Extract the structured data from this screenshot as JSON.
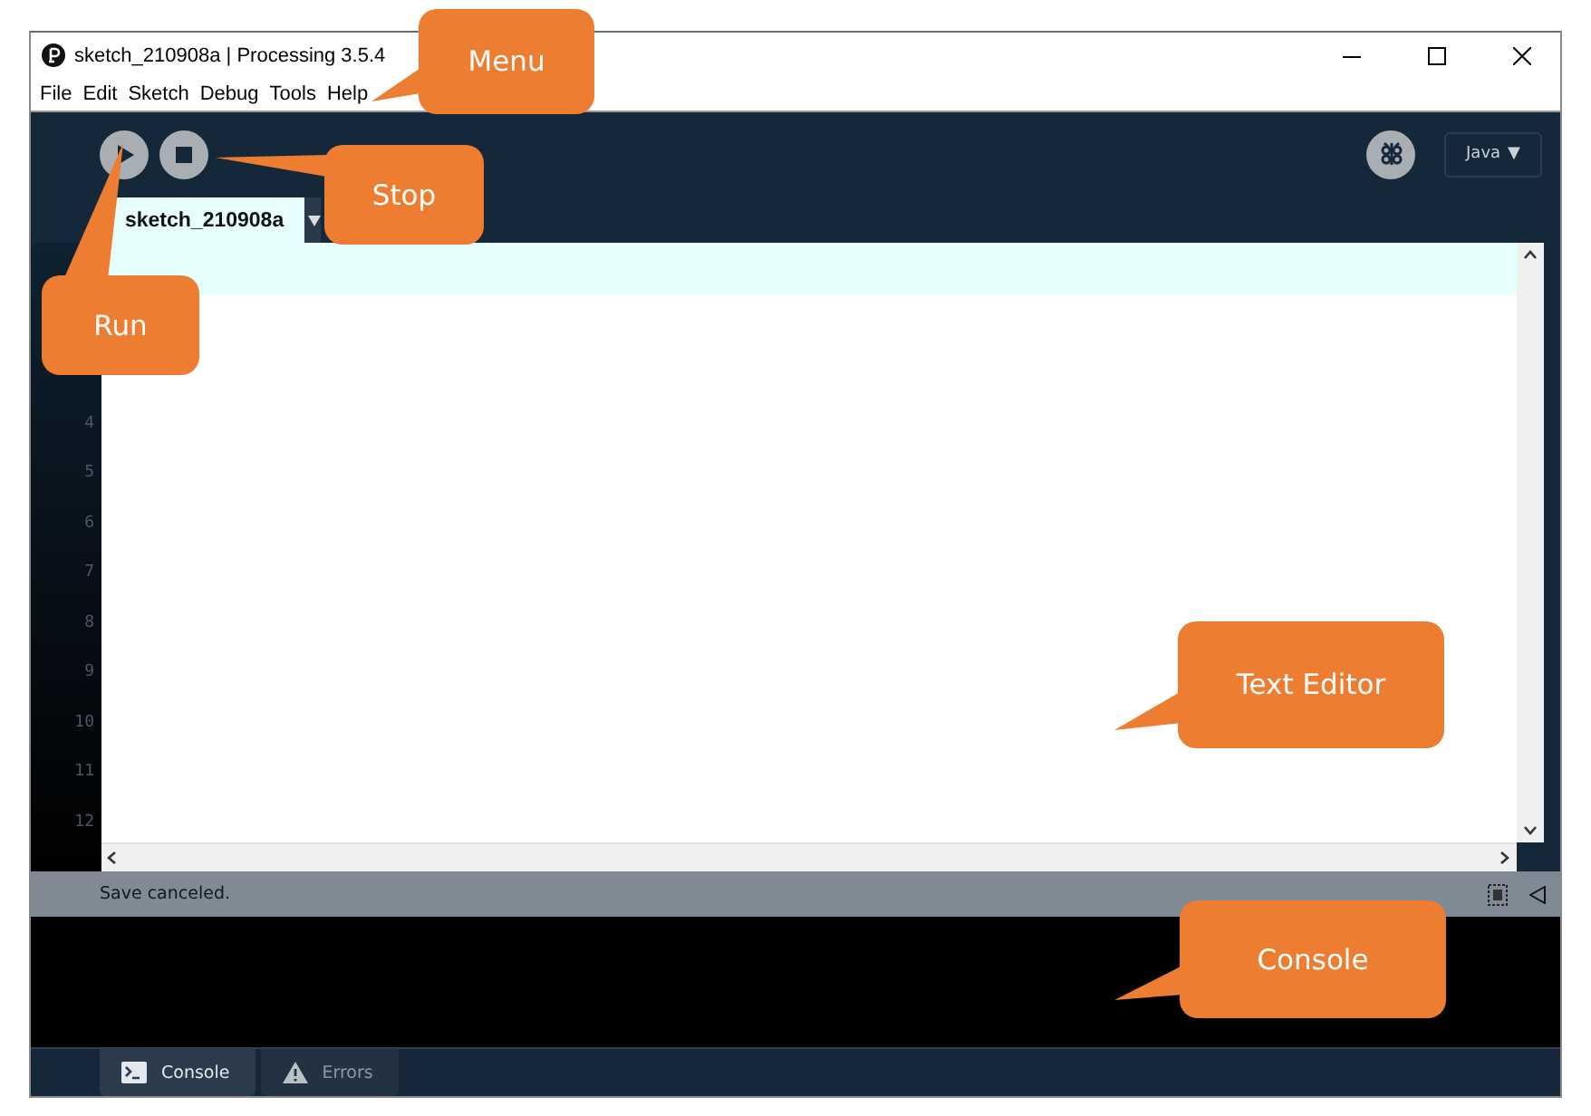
{
  "window": {
    "title": "sketch_210908a | Processing 3.5.4"
  },
  "menu": [
    "File",
    "Edit",
    "Sketch",
    "Debug",
    "Tools",
    "Help"
  ],
  "mode": {
    "label": "Java",
    "caret": "▼"
  },
  "editor_tabs": [
    {
      "label": "sketch_210908a",
      "selected": true
    }
  ],
  "editor": {
    "line_numbers": [
      "4",
      "5",
      "6",
      "7",
      "8",
      "9",
      "10",
      "11",
      "12"
    ]
  },
  "status_bar": {
    "message": "Save canceled."
  },
  "console_tabs": [
    {
      "label": "Console",
      "kind": "console",
      "selected": true
    },
    {
      "label": "Errors",
      "kind": "errors",
      "selected": false
    }
  ],
  "callouts": [
    {
      "label": "Menu"
    },
    {
      "label": "Stop"
    },
    {
      "label": "Run"
    },
    {
      "label": "Text Editor"
    },
    {
      "label": "Console"
    }
  ]
}
